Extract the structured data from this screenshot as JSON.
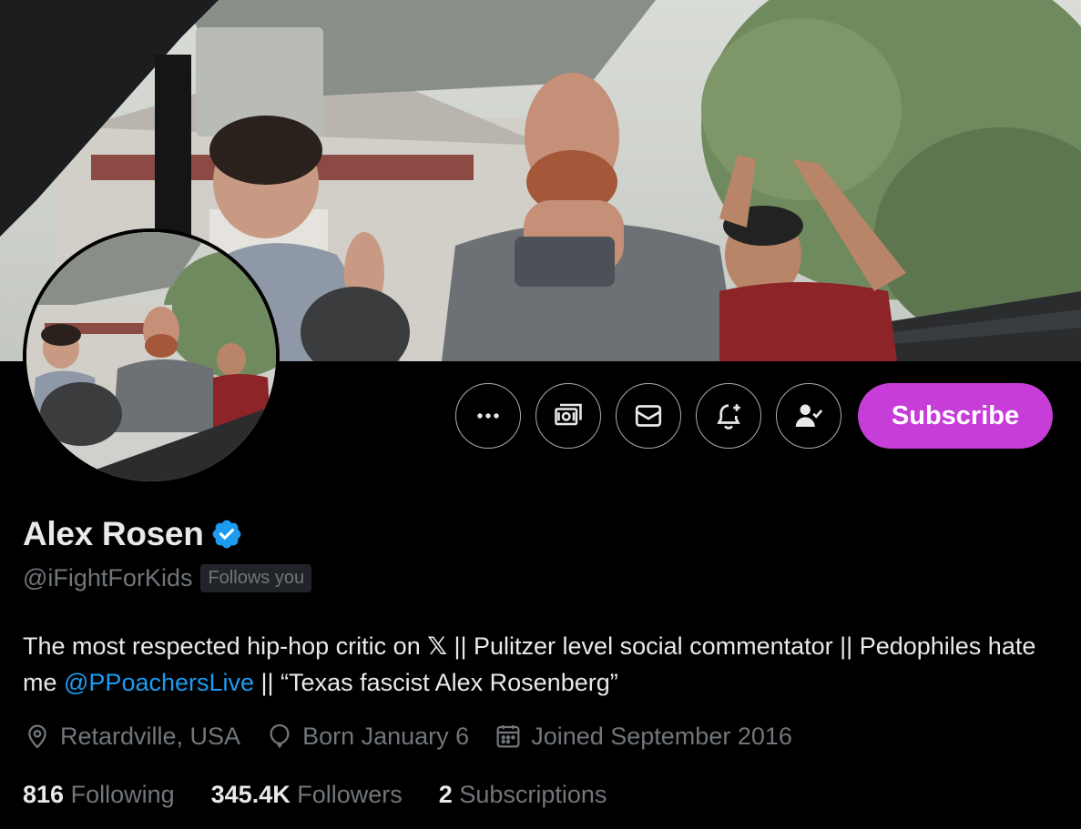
{
  "profile": {
    "name": "Alex Rosen",
    "handle": "@iFightForKids",
    "follows_you": "Follows you",
    "bio": {
      "part1": "The most respected hip-hop critic on ",
      "x_symbol": "𝕏",
      "part2": " || Pulitzer level social commentator || Pedophiles hate me ",
      "mention": "@PPoachersLive",
      "part3": " || “Texas fascist Alex Rosenberg”"
    },
    "location": "Retardville, USA",
    "birthday": "Born January 6",
    "joined": "Joined September 2016"
  },
  "stats": {
    "following_count": "816",
    "following_label": "Following",
    "followers_count": "345.4K",
    "followers_label": "Followers",
    "subscriptions_count": "2",
    "subscriptions_label": "Subscriptions"
  },
  "actions": {
    "subscribe_label": "Subscribe",
    "icons": [
      "more-icon",
      "tip-icon",
      "message-icon",
      "notifications-icon",
      "following-icon"
    ]
  },
  "colors": {
    "background": "#000000",
    "accent_link": "#1d9bf0",
    "subscribe": "#c73dd8",
    "verified": "#1d9bf0",
    "muted_text": "#71767b"
  }
}
